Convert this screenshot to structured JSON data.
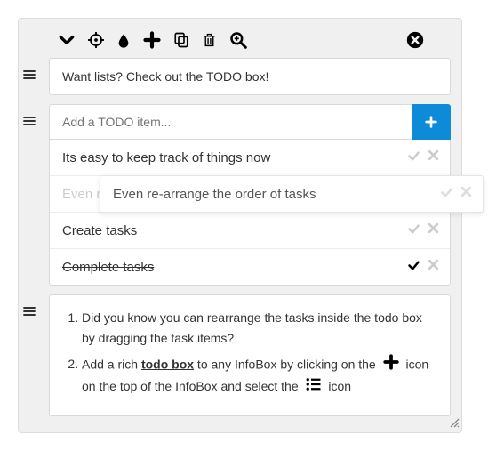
{
  "title": "Want lists? Check out the TODO box!",
  "todo": {
    "placeholder": "Add a TODO item...",
    "items": [
      {
        "text": "Its easy to keep track of things now",
        "completed": false,
        "faded": false
      },
      {
        "text": "Even re-arrange the order of tasks",
        "completed": false,
        "faded": true
      },
      {
        "text": "Create tasks",
        "completed": false,
        "faded": false
      },
      {
        "text": "Complete tasks",
        "completed": true,
        "faded": false
      }
    ],
    "ghost_text": "Even re-arrange the order of tasks"
  },
  "tips": {
    "item1": "Did you know you can rearrange the tasks inside the todo box by dragging the task items?",
    "item2_a": "Add a rich ",
    "item2_bold": "todo box",
    "item2_b": " to any InfoBox by clicking on the ",
    "item2_c": " icon on the top of the InfoBox and select the ",
    "item2_d": " icon"
  },
  "colors": {
    "accent": "#0d8bd9"
  }
}
